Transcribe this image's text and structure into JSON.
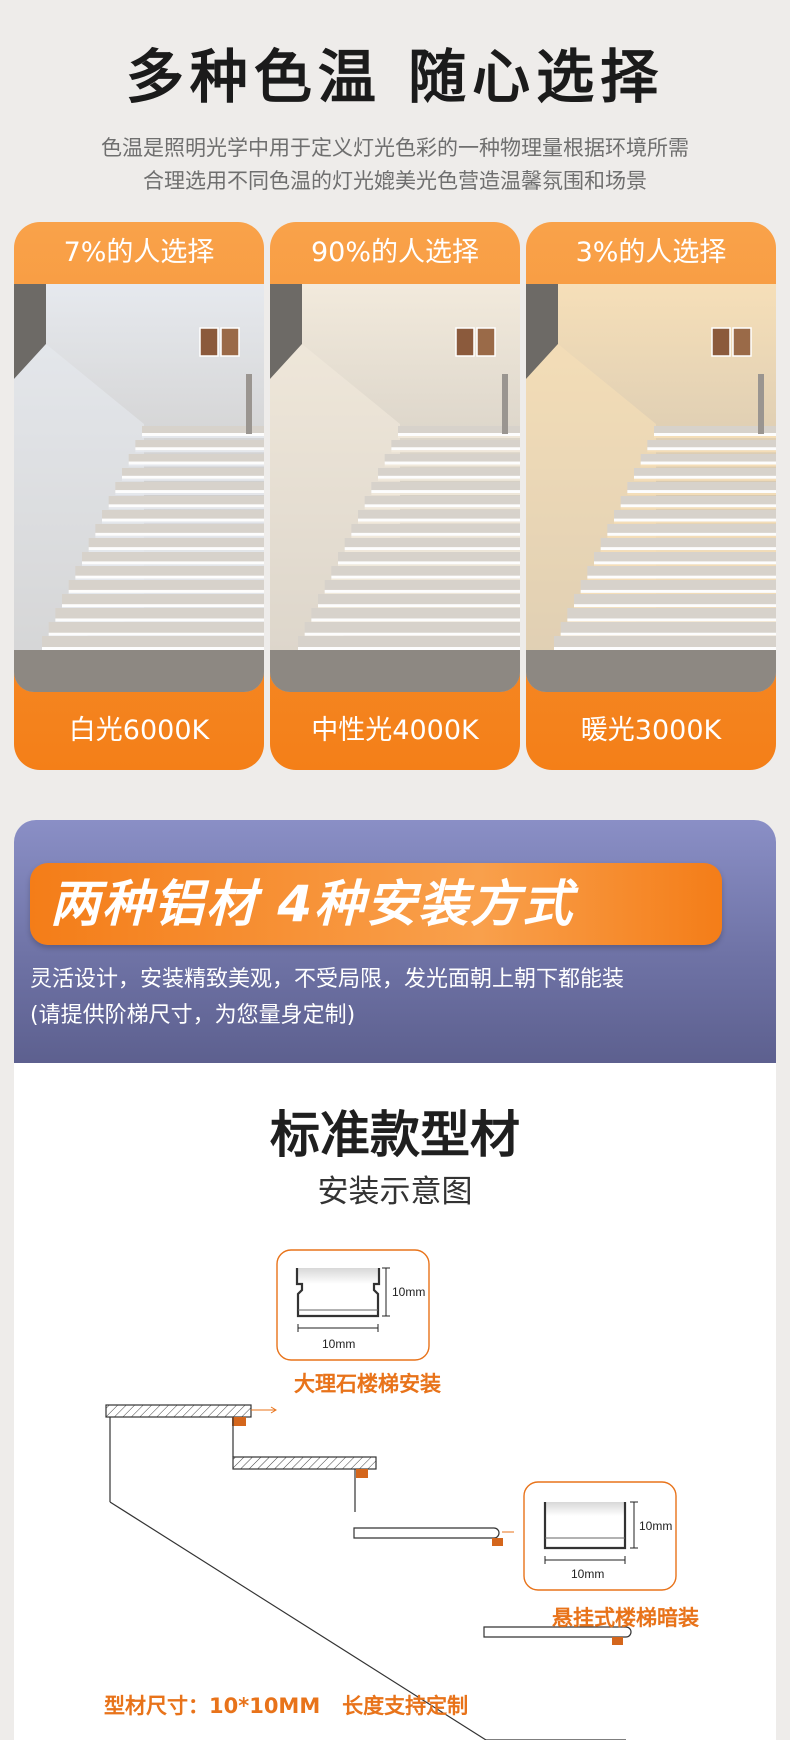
{
  "header": {
    "title": "多种色温 随心选择",
    "intro_line1": "色温是照明光学中用于定义灯光色彩的一种物理量根据环境所需",
    "intro_line2": "合理选用不同色温的灯光媲美光色营造温馨氛围和场景"
  },
  "cards": [
    {
      "percent": "7%的人选择",
      "name": "白光6000K",
      "tone": "#e6e9ee"
    },
    {
      "percent": "90%的人选择",
      "name": "中性光4000K",
      "tone": "#f2eadc"
    },
    {
      "percent": "3%的人选择",
      "name": "暖光3000K",
      "tone": "#f6dfb8"
    }
  ],
  "section2": {
    "banner": "两种铝材 4种安装方式",
    "sub_line1": "灵活设计，安装精致美观，不受局限，发光面朝上朝下都能装",
    "sub_line2": "(请提供阶梯尺寸，为您量身定制)"
  },
  "standard": {
    "title": "标准款型材",
    "subtitle": "安装示意图",
    "profile1": {
      "height": "10mm",
      "width": "10mm"
    },
    "profile2": {
      "height": "10mm",
      "width": "10mm"
    },
    "label_marble": "大理石楼梯安装",
    "label_hanging": "悬挂式楼梯暗装",
    "spec": "型材尺寸：10*10MM   长度支持定制"
  },
  "colors": {
    "accent_orange": "#f47f18",
    "banner_purple": "#8a8fc6",
    "label_orange": "#e8731a"
  }
}
